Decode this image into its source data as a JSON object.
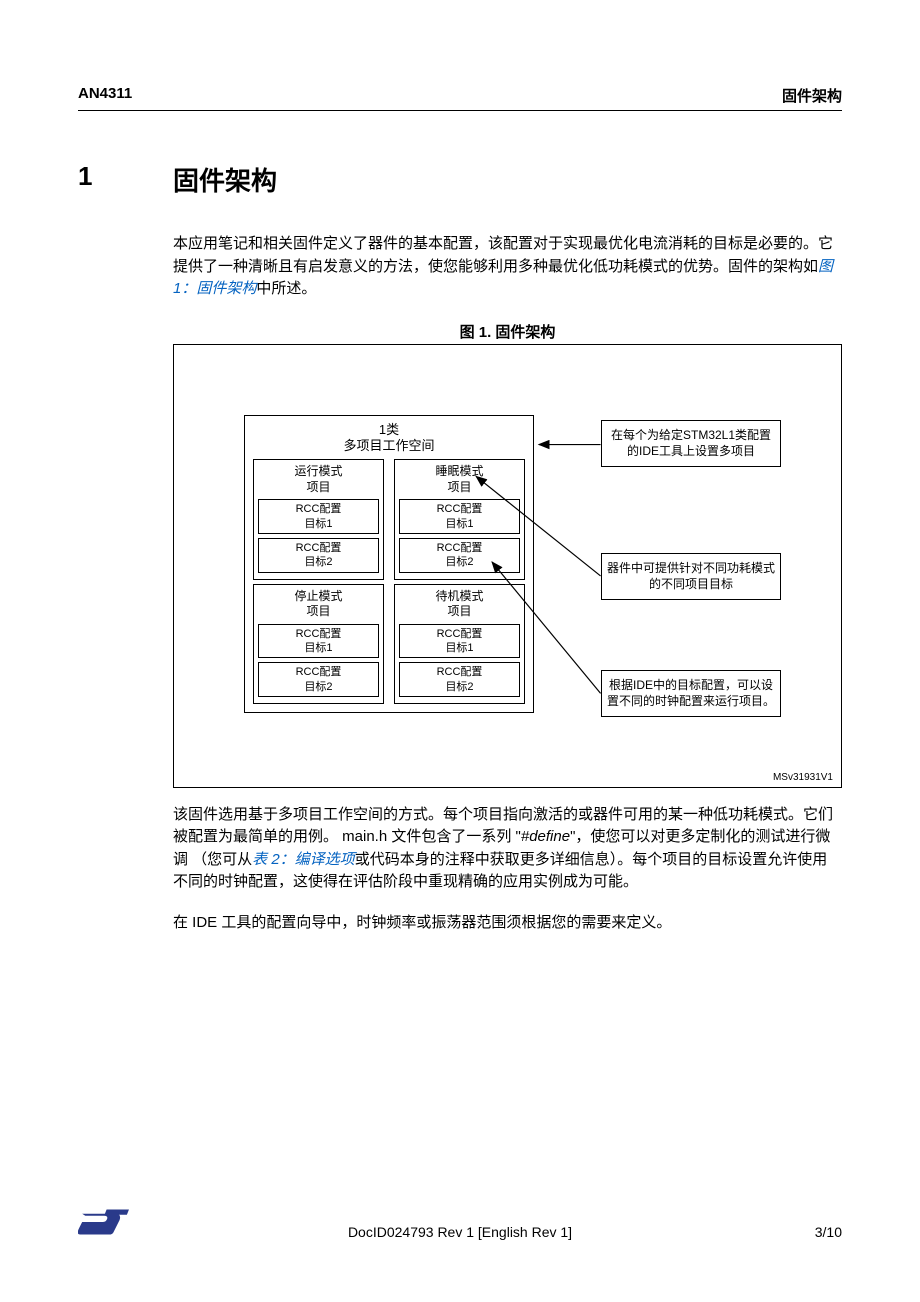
{
  "header": {
    "left": "AN4311",
    "right": "固件架构"
  },
  "section": {
    "num": "1",
    "title": "固件架构"
  },
  "intro": {
    "t1": "本应用笔记和相关固件定义了器件的基本配置，该配置对于实现最优化电流消耗的目标是必要的。它提供了一种清晰且有启发意义的方法，使您能够利用多种最优化低功耗模式的优势。固件的架构如",
    "link1": "图 1：固件架构",
    "t2": "中所述。"
  },
  "fig": {
    "caption": "图 1. 固件架构",
    "ws_title_l1": "1类",
    "ws_title_l2": "多项目工作空间",
    "proj_run": "运行模式\n项目",
    "proj_sleep": "睡眠模式\n项目",
    "proj_stop": "停止模式\n项目",
    "proj_standby": "待机模式\n项目",
    "rcc1": "RCC配置\n目标1",
    "rcc2": "RCC配置\n目标2",
    "annot1": "在每个为给定STM32L1类配置的IDE工具上设置多项目",
    "annot2": "器件中可提供针对不同功耗模式的不同项目目标",
    "annot3": "根据IDE中的目标配置，可以设置不同的时钟配置来运行项目。",
    "msv": "MSv31931V1"
  },
  "after": {
    "p1a": "该固件选用基于多项目工作空间的方式。每个项目指向激活的或器件可用的某一种低功耗模式。它们被配置为最简单的用例。 main.h 文件包含了一系列 \"",
    "p1b": "#define",
    "p1c": "\"，使您可以对更多定制化的测试进行微调 （您可从",
    "link2": "表 2：编译选项",
    "p1d": "或代码本身的注释中获取更多详细信息）。每个项目的目标设置允许使用不同的时钟配置，这使得在评估阶段中重现精确的应用实例成为可能。",
    "p2": "在 IDE 工具的配置向导中，时钟频率或振荡器范围须根据您的需要来定义。"
  },
  "footer": {
    "docid": "DocID024793 Rev 1 [English Rev 1]",
    "page": "3/10"
  }
}
